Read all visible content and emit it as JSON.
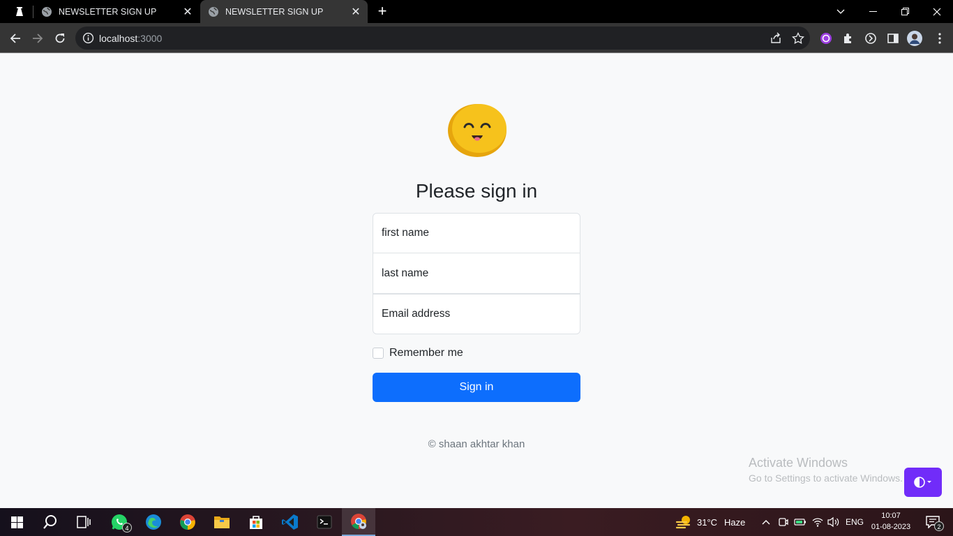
{
  "browser": {
    "tabs": [
      {
        "title": "NEWSLETTER SIGN UP",
        "active": false
      },
      {
        "title": "NEWSLETTER SIGN UP",
        "active": true
      }
    ],
    "url_host": "localhost",
    "url_port": ":3000"
  },
  "page": {
    "heading": "Please sign in",
    "fields": {
      "first_name_placeholder": "first name",
      "last_name_placeholder": "last name",
      "email_placeholder": "Email address"
    },
    "remember_label": "Remember me",
    "remember_checked": false,
    "signin_label": "Sign in",
    "footer": "© shaan akhtar khan",
    "primary_color": "#0d6efd",
    "theme_toggle_color": "#712cf9"
  },
  "watermark": {
    "title": "Activate Windows",
    "subtitle": "Go to Settings to activate Windows."
  },
  "taskbar": {
    "apps": [
      {
        "name": "whatsapp-icon",
        "badge": "4"
      },
      {
        "name": "edge-icon",
        "badge": ""
      },
      {
        "name": "chrome-icon",
        "badge": ""
      },
      {
        "name": "file-explorer-icon",
        "badge": ""
      },
      {
        "name": "microsoft-store-icon",
        "badge": ""
      },
      {
        "name": "vscode-icon",
        "badge": ""
      },
      {
        "name": "terminal-icon",
        "badge": ""
      },
      {
        "name": "chrome-profile-icon",
        "badge": ""
      }
    ],
    "weather": "31°C",
    "weather_desc": "Haze",
    "language": "ENG",
    "time": "10:07",
    "date": "01-08-2023",
    "notifications": "2"
  }
}
